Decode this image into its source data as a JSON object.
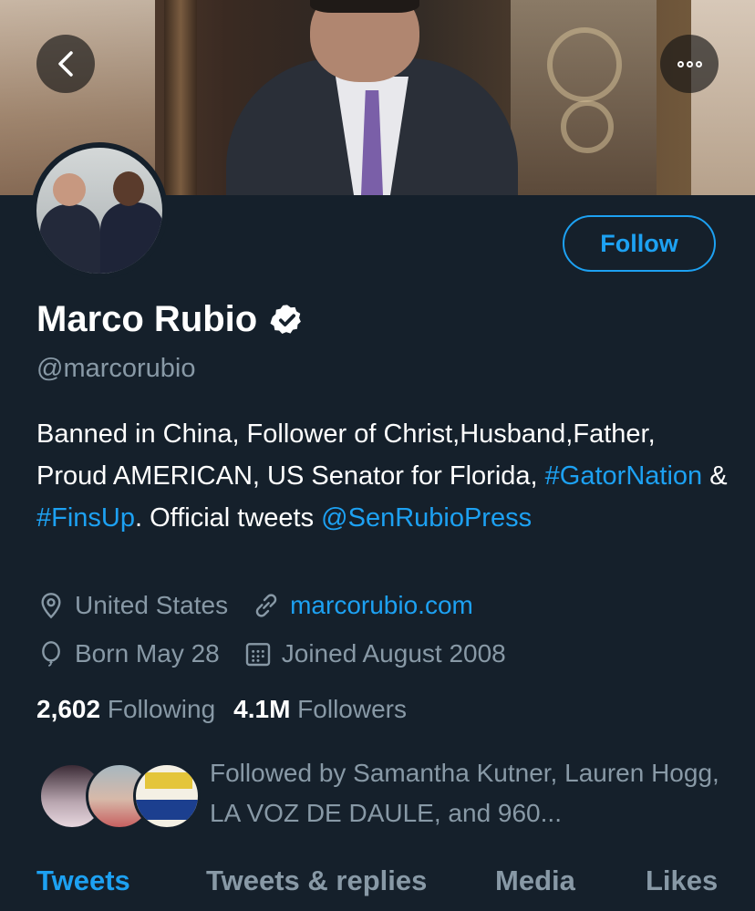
{
  "header": {
    "back_icon": "chevron-left-icon",
    "more_icon": "more-dots-icon"
  },
  "profile": {
    "name": "Marco Rubio",
    "handle": "@marcorubio",
    "follow_label": "Follow",
    "verified": true,
    "bio": {
      "part1": "Banned in China, Follower of Christ,Husband,Father, Proud AMERICAN, US Senator for Florida, ",
      "tag1": "#GatorNation",
      "amp": " & ",
      "tag2": "#FinsUp",
      "part2": ". Official tweets ",
      "mention": "@SenRubioPress"
    },
    "location": "United States",
    "website": "marcorubio.com",
    "birthday": "Born May 28",
    "joined": "Joined August 2008",
    "following_count": "2,602",
    "following_label": "Following",
    "followers_count": "4.1M",
    "followers_label": "Followers",
    "followed_by": "Followed by Samantha Kutner, Lauren Hogg, LA VOZ DE DAULE, and 960..."
  },
  "tabs": [
    {
      "label": "Tweets",
      "active": true
    },
    {
      "label": "Tweets & replies",
      "active": false
    },
    {
      "label": "Media",
      "active": false
    },
    {
      "label": "Likes",
      "active": false
    }
  ],
  "colors": {
    "background": "#15202b",
    "accent": "#1da1f2",
    "secondary_text": "#8899a6"
  }
}
